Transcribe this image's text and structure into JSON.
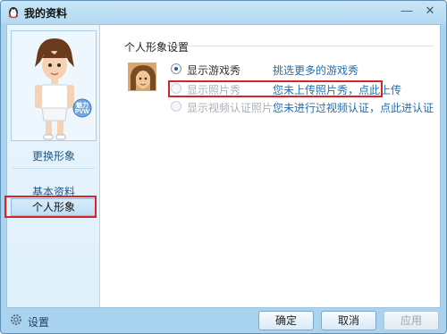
{
  "window": {
    "title": "我的资料"
  },
  "sidebar": {
    "change_avatar_link": "更换形象",
    "items": [
      {
        "label": "基本资料"
      },
      {
        "label": "个人形象"
      }
    ],
    "badge_text": [
      "魅力",
      "PVW"
    ]
  },
  "main": {
    "section_title": "个人形象设置",
    "options": [
      {
        "label": "显示游戏秀",
        "link": "挑选更多的游戏秀",
        "checked": true,
        "disabled": false
      },
      {
        "label": "显示照片秀",
        "link": "您未上传照片秀，点此上传",
        "checked": false,
        "disabled": true
      },
      {
        "label": "显示视频认证照片",
        "link": "您未进行过视频认证，点此进认证",
        "checked": false,
        "disabled": true
      }
    ]
  },
  "footer": {
    "settings_label": "设置",
    "ok_label": "确定",
    "cancel_label": "取消",
    "apply_label": "应用"
  },
  "colors": {
    "highlight": "#d8232a",
    "link": "#1f6fb4"
  },
  "icons": {
    "app": "qq-penguin-icon",
    "settings": "gear-icon",
    "minimize": "minimize-icon",
    "close": "close-icon"
  }
}
